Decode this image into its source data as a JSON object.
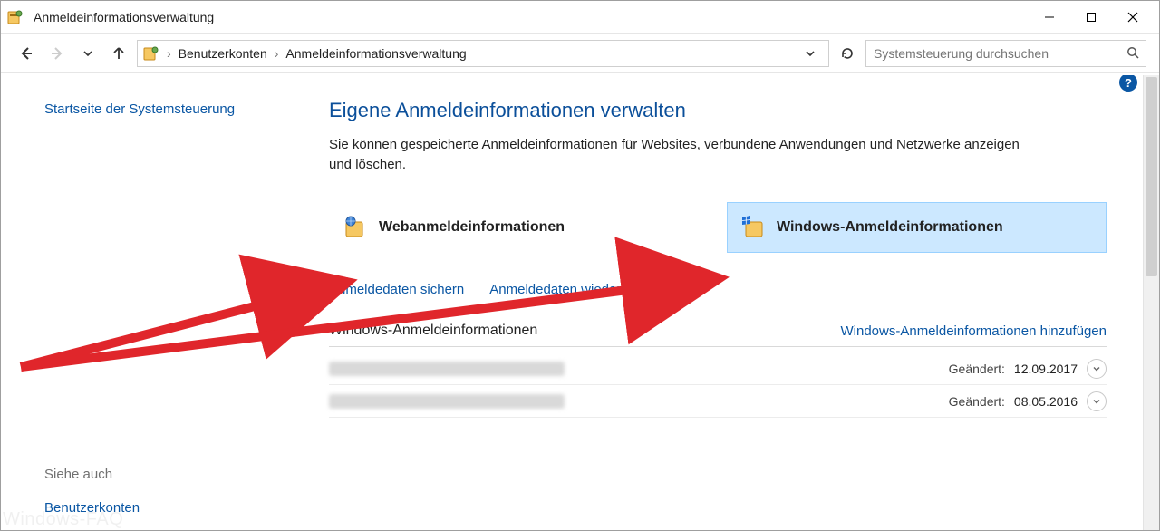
{
  "window": {
    "title": "Anmeldeinformationsverwaltung"
  },
  "breadcrumbs": {
    "root": "",
    "seg1": "Benutzerkonten",
    "seg2": "Anmeldeinformationsverwaltung"
  },
  "search": {
    "placeholder": "Systemsteuerung durchsuchen"
  },
  "sidebar": {
    "home": "Startseite der Systemsteuerung",
    "see_also_label": "Siehe auch",
    "see_also_link": "Benutzerkonten"
  },
  "page": {
    "title": "Eigene Anmeldeinformationen verwalten",
    "desc": "Sie können gespeicherte Anmeldeinformationen für Websites, verbundene Anwendungen und Netzwerke anzeigen und löschen."
  },
  "tabs": {
    "web": "Webanmeldeinformationen",
    "windows": "Windows-Anmeldeinformationen"
  },
  "links": {
    "backup": "Anmeldedaten sichern",
    "restore": "Anmeldedaten wiederherstellen"
  },
  "section": {
    "title": "Windows-Anmeldeinformationen",
    "add_link": "Windows-Anmeldeinformationen hinzufügen",
    "changed_label": "Geändert:"
  },
  "entries": [
    {
      "date": "12.09.2017"
    },
    {
      "date": "08.05.2016"
    }
  ],
  "watermark": "Windows-FAQ"
}
